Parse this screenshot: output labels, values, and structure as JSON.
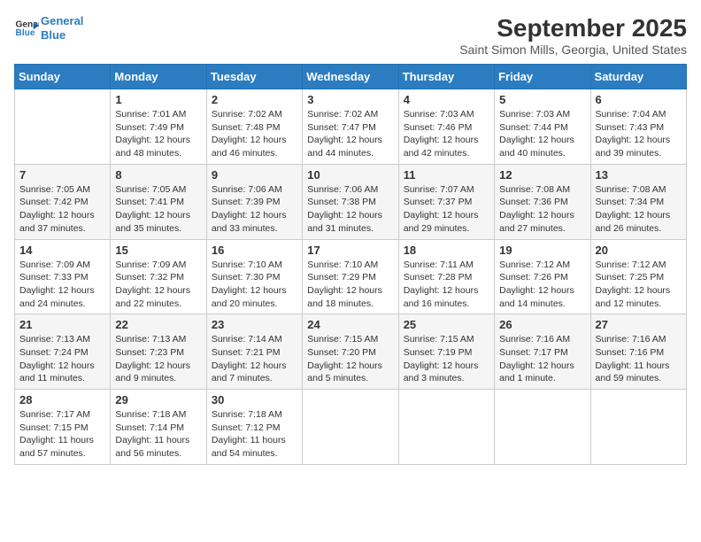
{
  "header": {
    "logo_line1": "General",
    "logo_line2": "Blue",
    "month": "September 2025",
    "location": "Saint Simon Mills, Georgia, United States"
  },
  "days_of_week": [
    "Sunday",
    "Monday",
    "Tuesday",
    "Wednesday",
    "Thursday",
    "Friday",
    "Saturday"
  ],
  "weeks": [
    [
      {
        "day": "",
        "info": ""
      },
      {
        "day": "1",
        "info": "Sunrise: 7:01 AM\nSunset: 7:49 PM\nDaylight: 12 hours\nand 48 minutes."
      },
      {
        "day": "2",
        "info": "Sunrise: 7:02 AM\nSunset: 7:48 PM\nDaylight: 12 hours\nand 46 minutes."
      },
      {
        "day": "3",
        "info": "Sunrise: 7:02 AM\nSunset: 7:47 PM\nDaylight: 12 hours\nand 44 minutes."
      },
      {
        "day": "4",
        "info": "Sunrise: 7:03 AM\nSunset: 7:46 PM\nDaylight: 12 hours\nand 42 minutes."
      },
      {
        "day": "5",
        "info": "Sunrise: 7:03 AM\nSunset: 7:44 PM\nDaylight: 12 hours\nand 40 minutes."
      },
      {
        "day": "6",
        "info": "Sunrise: 7:04 AM\nSunset: 7:43 PM\nDaylight: 12 hours\nand 39 minutes."
      }
    ],
    [
      {
        "day": "7",
        "info": "Sunrise: 7:05 AM\nSunset: 7:42 PM\nDaylight: 12 hours\nand 37 minutes."
      },
      {
        "day": "8",
        "info": "Sunrise: 7:05 AM\nSunset: 7:41 PM\nDaylight: 12 hours\nand 35 minutes."
      },
      {
        "day": "9",
        "info": "Sunrise: 7:06 AM\nSunset: 7:39 PM\nDaylight: 12 hours\nand 33 minutes."
      },
      {
        "day": "10",
        "info": "Sunrise: 7:06 AM\nSunset: 7:38 PM\nDaylight: 12 hours\nand 31 minutes."
      },
      {
        "day": "11",
        "info": "Sunrise: 7:07 AM\nSunset: 7:37 PM\nDaylight: 12 hours\nand 29 minutes."
      },
      {
        "day": "12",
        "info": "Sunrise: 7:08 AM\nSunset: 7:36 PM\nDaylight: 12 hours\nand 27 minutes."
      },
      {
        "day": "13",
        "info": "Sunrise: 7:08 AM\nSunset: 7:34 PM\nDaylight: 12 hours\nand 26 minutes."
      }
    ],
    [
      {
        "day": "14",
        "info": "Sunrise: 7:09 AM\nSunset: 7:33 PM\nDaylight: 12 hours\nand 24 minutes."
      },
      {
        "day": "15",
        "info": "Sunrise: 7:09 AM\nSunset: 7:32 PM\nDaylight: 12 hours\nand 22 minutes."
      },
      {
        "day": "16",
        "info": "Sunrise: 7:10 AM\nSunset: 7:30 PM\nDaylight: 12 hours\nand 20 minutes."
      },
      {
        "day": "17",
        "info": "Sunrise: 7:10 AM\nSunset: 7:29 PM\nDaylight: 12 hours\nand 18 minutes."
      },
      {
        "day": "18",
        "info": "Sunrise: 7:11 AM\nSunset: 7:28 PM\nDaylight: 12 hours\nand 16 minutes."
      },
      {
        "day": "19",
        "info": "Sunrise: 7:12 AM\nSunset: 7:26 PM\nDaylight: 12 hours\nand 14 minutes."
      },
      {
        "day": "20",
        "info": "Sunrise: 7:12 AM\nSunset: 7:25 PM\nDaylight: 12 hours\nand 12 minutes."
      }
    ],
    [
      {
        "day": "21",
        "info": "Sunrise: 7:13 AM\nSunset: 7:24 PM\nDaylight: 12 hours\nand 11 minutes."
      },
      {
        "day": "22",
        "info": "Sunrise: 7:13 AM\nSunset: 7:23 PM\nDaylight: 12 hours\nand 9 minutes."
      },
      {
        "day": "23",
        "info": "Sunrise: 7:14 AM\nSunset: 7:21 PM\nDaylight: 12 hours\nand 7 minutes."
      },
      {
        "day": "24",
        "info": "Sunrise: 7:15 AM\nSunset: 7:20 PM\nDaylight: 12 hours\nand 5 minutes."
      },
      {
        "day": "25",
        "info": "Sunrise: 7:15 AM\nSunset: 7:19 PM\nDaylight: 12 hours\nand 3 minutes."
      },
      {
        "day": "26",
        "info": "Sunrise: 7:16 AM\nSunset: 7:17 PM\nDaylight: 12 hours\nand 1 minute."
      },
      {
        "day": "27",
        "info": "Sunrise: 7:16 AM\nSunset: 7:16 PM\nDaylight: 11 hours\nand 59 minutes."
      }
    ],
    [
      {
        "day": "28",
        "info": "Sunrise: 7:17 AM\nSunset: 7:15 PM\nDaylight: 11 hours\nand 57 minutes."
      },
      {
        "day": "29",
        "info": "Sunrise: 7:18 AM\nSunset: 7:14 PM\nDaylight: 11 hours\nand 56 minutes."
      },
      {
        "day": "30",
        "info": "Sunrise: 7:18 AM\nSunset: 7:12 PM\nDaylight: 11 hours\nand 54 minutes."
      },
      {
        "day": "",
        "info": ""
      },
      {
        "day": "",
        "info": ""
      },
      {
        "day": "",
        "info": ""
      },
      {
        "day": "",
        "info": ""
      }
    ]
  ]
}
